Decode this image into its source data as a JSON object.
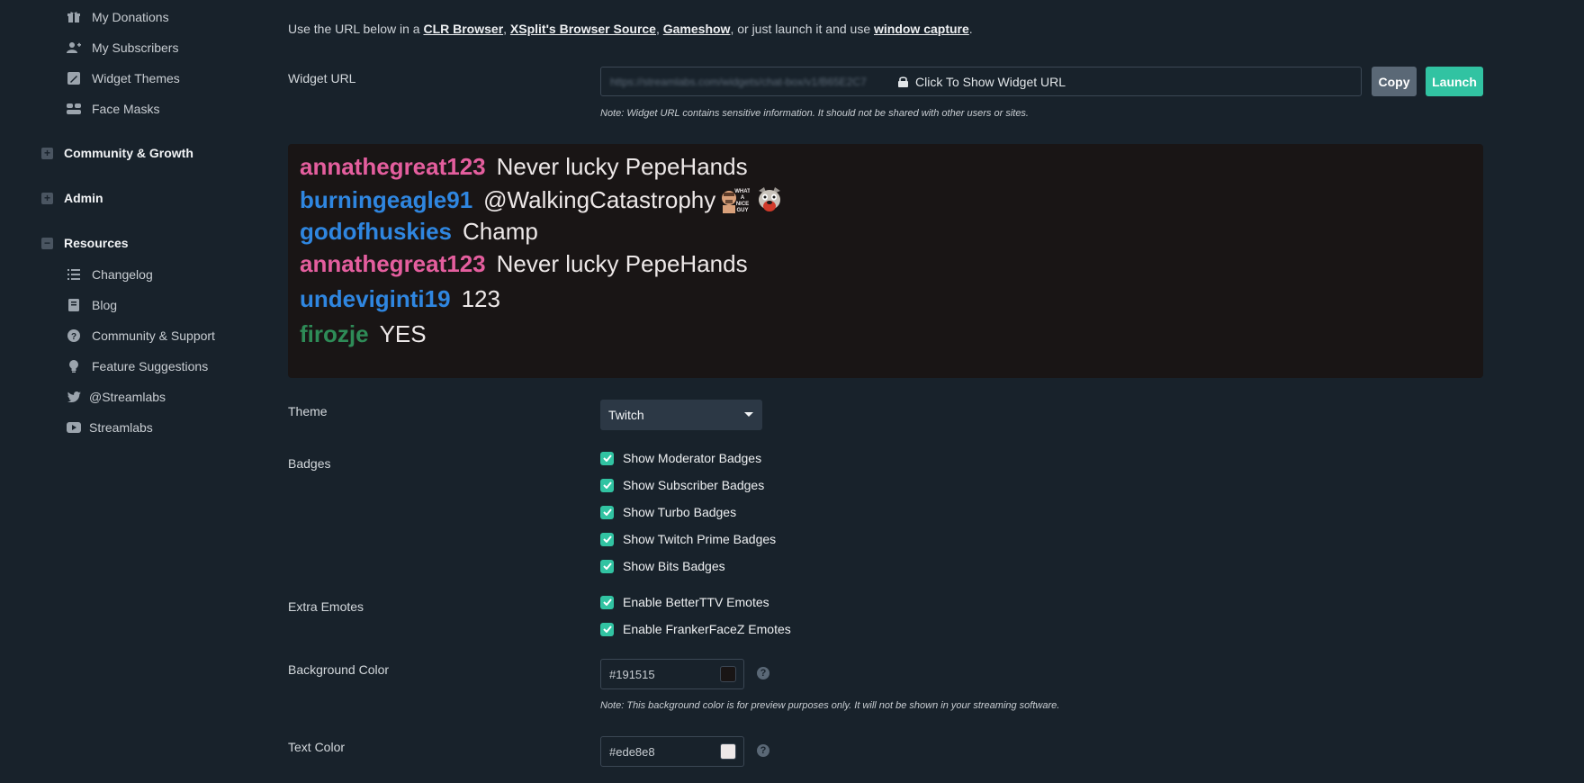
{
  "sidebar": {
    "items_top": [
      {
        "label": "My Donations",
        "icon": "gift-icon"
      },
      {
        "label": "My Subscribers",
        "icon": "user-plus-icon"
      },
      {
        "label": "Widget Themes",
        "icon": "brush-icon"
      },
      {
        "label": "Face Masks",
        "icon": "mask-icon"
      }
    ],
    "sections": [
      {
        "label": "Community & Growth",
        "state": "+"
      },
      {
        "label": "Admin",
        "state": "+"
      },
      {
        "label": "Resources",
        "state": "−"
      }
    ],
    "resources": [
      {
        "label": "Changelog",
        "icon": "list-icon"
      },
      {
        "label": "Blog",
        "icon": "book-icon"
      },
      {
        "label": "Community & Support",
        "icon": "question-circle-icon"
      },
      {
        "label": "Feature Suggestions",
        "icon": "lightbulb-icon"
      },
      {
        "label": "@Streamlabs",
        "icon": "twitter-icon"
      },
      {
        "label": "Streamlabs",
        "icon": "youtube-icon"
      }
    ]
  },
  "intro": {
    "prefix": "Use the URL below in a ",
    "link1": "CLR Browser",
    "sep1": ", ",
    "link2": "XSplit's Browser Source",
    "sep2": ", ",
    "link3": "Gameshow",
    "mid": ", or just launch it and use ",
    "link4": "window capture",
    "suffix": "."
  },
  "widget_url": {
    "label": "Widget URL",
    "blurred_text": "https://streamlabs.com/widgets/chat-box/v1/B65E2C7",
    "overlay": "Click To Show Widget URL",
    "copy_label": "Copy",
    "launch_label": "Launch",
    "note": "Note: Widget URL contains sensitive information. It should not be shared with other users or sites."
  },
  "chat_preview": {
    "background": "#191515",
    "lines": [
      {
        "user": "annathegreat123",
        "color": "#e45e9e",
        "msg": "Never lucky PepeHands"
      },
      {
        "user": "burningeagle91",
        "color": "#2f86e0",
        "msg": "@WalkingCatastrophy",
        "emotes": [
          "what-a-nice-guy-emote",
          "dog-emote"
        ]
      },
      {
        "user": "godofhuskies",
        "color": "#2f86e0",
        "msg": "Champ"
      },
      {
        "user": "annathegreat123",
        "color": "#e45e9e",
        "msg": "Never lucky PepeHands"
      },
      {
        "user": "undeviginti19",
        "color": "#2f86e0",
        "msg": "123"
      },
      {
        "user": "firozje",
        "color": "#2e8b57",
        "msg": "YES"
      }
    ],
    "emote_text": {
      "what_a_nice_guy": "WHAT A NICE GUY"
    }
  },
  "theme": {
    "label": "Theme",
    "value": "Twitch"
  },
  "badges": {
    "label": "Badges",
    "options": [
      "Show Moderator Badges",
      "Show Subscriber Badges",
      "Show Turbo Badges",
      "Show Twitch Prime Badges",
      "Show Bits Badges"
    ]
  },
  "extra_emotes": {
    "label": "Extra Emotes",
    "options": [
      "Enable BetterTTV Emotes",
      "Enable FrankerFaceZ Emotes"
    ]
  },
  "background_color": {
    "label": "Background Color",
    "value": "#191515",
    "note": "Note: This background color is for preview purposes only. It will not be shown in your streaming software."
  },
  "text_color": {
    "label": "Text Color",
    "value": "#ede8e8"
  },
  "colors": {
    "accent": "#31c3a2",
    "sidebar_bg": "#18222b",
    "copy_btn": "#5a6876"
  }
}
